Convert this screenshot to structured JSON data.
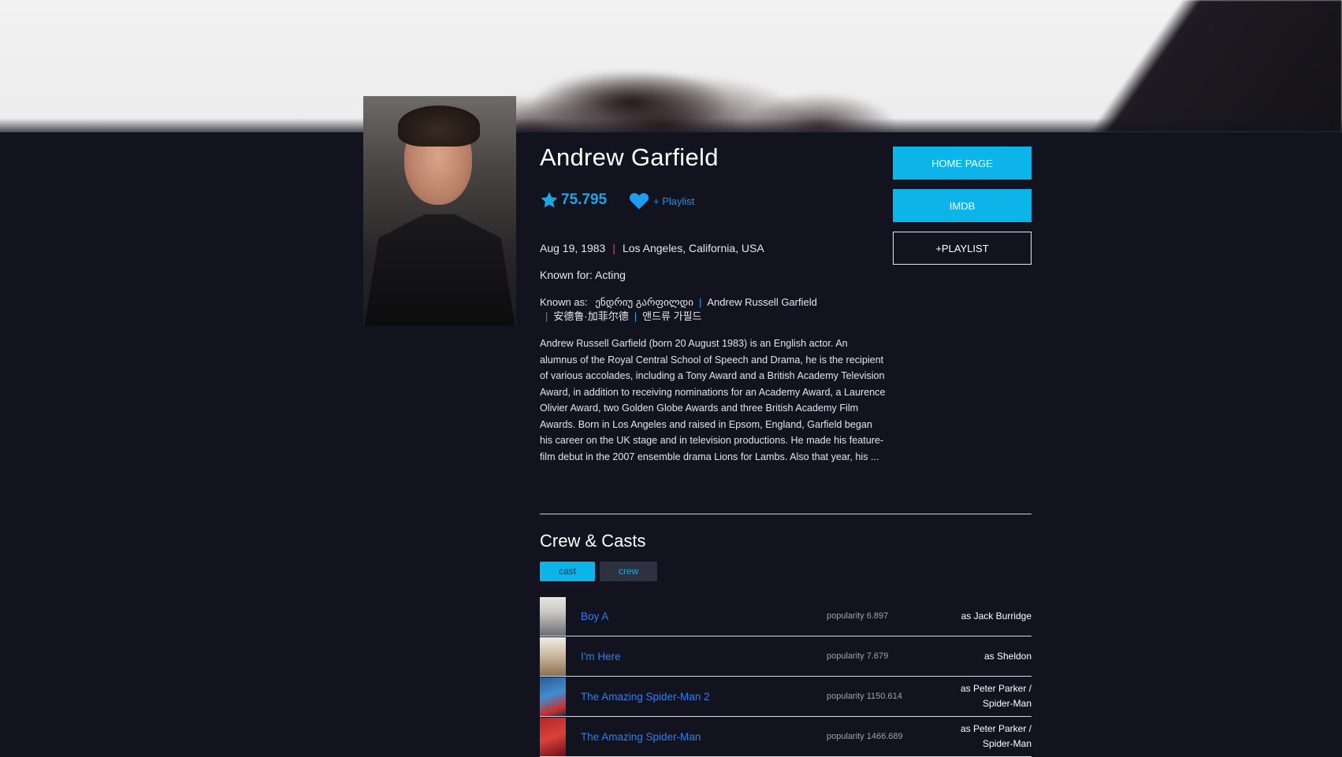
{
  "person": {
    "name": "Andrew Garfield",
    "score": "75.795",
    "playlist_link": "+ Playlist",
    "birthday": "Aug 19, 1983",
    "birthplace": "Los Angeles, California, USA",
    "known_for": "Known for: Acting",
    "known_as_label": "Known as:",
    "aliases": [
      "ენდრიუ გარფილდი",
      "Andrew Russell Garfield",
      "安德鲁·加菲尔德",
      "앤드류 가필드"
    ],
    "bio": "Andrew Russell Garfield (born 20 August 1983) is an English actor. An alumnus of the Royal Central School of Speech and Drama, he is the recipient of various accolades, including a Tony Award and a British Academy Television Award, in addition to receiving nominations for an Academy Award, a Laurence Olivier Award, two Golden Globe Awards and three British Academy Film Awards. Born in Los Angeles and raised in Epsom, England, Garfield began his career on the UK stage and in television productions. He made his feature-film debut in the 2007 ensemble drama Lions for Lambs. Also that year, his ..."
  },
  "actions": {
    "home_page": "HOME PAGE",
    "imdb": "IMDB",
    "playlist": "+PLAYLIST"
  },
  "credits": {
    "title": "Crew & Casts",
    "tabs": [
      "cast",
      "crew"
    ],
    "active_tab": "cast",
    "rows": [
      {
        "title": "Boy A",
        "popularity": "popularity 6.897",
        "role": "as Jack Burridge"
      },
      {
        "title": "I'm Here",
        "popularity": "popularity 7.679",
        "role": "as Sheldon"
      },
      {
        "title": "The Amazing Spider-Man 2",
        "popularity": "popularity 1150.614",
        "role": "as Peter Parker / Spider-Man"
      },
      {
        "title": "The Amazing Spider-Man",
        "popularity": "popularity 1466.689",
        "role": "as Peter Parker / Spider-Man"
      }
    ]
  },
  "colors": {
    "accent": "#0cb4ea",
    "background": "#12131f",
    "link": "#2a80f0",
    "separator": "#e0408e"
  },
  "icons": {
    "rating": "star-icon",
    "favorite": "heart-icon"
  }
}
